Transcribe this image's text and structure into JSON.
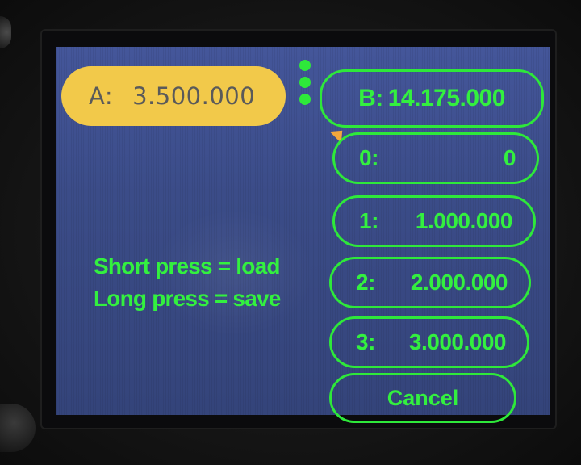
{
  "vfo_a": {
    "label": "A:",
    "frequency": "3.500.000",
    "color": "#f2c94a"
  },
  "vfo_b": {
    "label": "B:",
    "frequency": "14.175.000"
  },
  "memories": [
    {
      "slot": "0:",
      "frequency": "0"
    },
    {
      "slot": "1:",
      "frequency": "1.000.000"
    },
    {
      "slot": "2:",
      "frequency": "2.000.000"
    },
    {
      "slot": "3:",
      "frequency": "3.000.000"
    }
  ],
  "cancel_label": "Cancel",
  "help": {
    "line1": "Short press = load",
    "line2": "Long press = save"
  },
  "menu_icon": "vertical-dots-icon",
  "colors": {
    "accent_green": "#2ee83a",
    "background_blue": "#3c4e8a",
    "selection_marker": "#f2a63c"
  }
}
